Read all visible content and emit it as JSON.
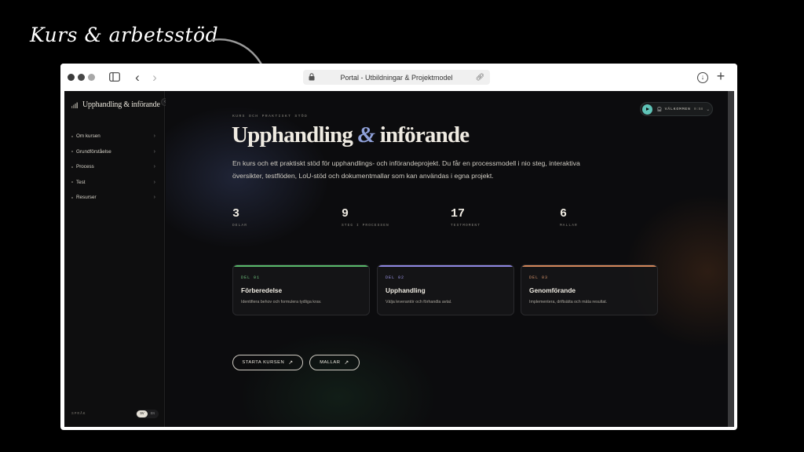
{
  "annotation": {
    "text": "Kurs & arbetsstöd"
  },
  "browser": {
    "address": "Portal - Utbildningar & Projektmodel",
    "icons": [
      "sidebar-toggle-icon",
      "back-icon",
      "forward-icon",
      "lock-icon",
      "link-icon",
      "download-icon",
      "new-tab-icon"
    ]
  },
  "sidebar": {
    "brand": "Upphandling & införande",
    "items": [
      {
        "label": "Om kursen"
      },
      {
        "label": "Grundförståelse"
      },
      {
        "label": "Process"
      },
      {
        "label": "Test"
      },
      {
        "label": "Resurser"
      }
    ],
    "language_label": "SPRÅK",
    "languages": [
      "SV",
      "EN"
    ],
    "active_language": "SV"
  },
  "audio": {
    "label": "VÄLKOMMEN",
    "time": "0:58"
  },
  "hero": {
    "eyebrow": "KURS OCH PRAKTISKT STÖD",
    "title_part1": "Upphandling",
    "title_amp": "&",
    "title_part2": "införande",
    "description": "En kurs och ett praktiskt stöd för upphandlings- och införandeprojekt. Du får en processmodell i nio steg, interaktiva översikter, testflöden, LoU-stöd och dokumentmallar som kan användas i egna projekt."
  },
  "stats": [
    {
      "value": "3",
      "label": "DELAR"
    },
    {
      "value": "9",
      "label": "STEG I PROCESSEN"
    },
    {
      "value": "17",
      "label": "TESTMOMENT"
    },
    {
      "value": "6",
      "label": "MALLAR"
    }
  ],
  "cards": [
    {
      "tag": "DEL 01",
      "title": "Förberedelse",
      "description": "Identifiera behov och formulera tydliga krav.",
      "color": "#58b86a"
    },
    {
      "tag": "DEL 02",
      "title": "Upphandling",
      "description": "Välja leverantör och förhandla avtal.",
      "color": "#8d86e0"
    },
    {
      "tag": "DEL 03",
      "title": "Genomförande",
      "description": "Implementera, driftsätta och mäta resultat.",
      "color": "#d2875a"
    }
  ],
  "buttons": {
    "start": "STARTA KURSEN",
    "templates": "MALLAR"
  },
  "colors": {
    "background": "#0b0b0c",
    "accent_teal": "#5fc3b7",
    "accent_periwinkle": "#8fa0d8"
  }
}
